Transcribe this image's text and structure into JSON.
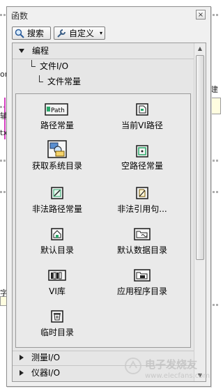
{
  "background": {
    "left_fragment_1": "or",
    "left_fragment_2": "辅",
    "left_fragment_3": "tx",
    "left_fragment_4": "字",
    "right_fragment_1": "建"
  },
  "palette": {
    "title": "函数",
    "close_glyph": "×",
    "toolbar": {
      "search_label": "搜索",
      "customize_label": "自定义",
      "customize_arrow": "▾"
    },
    "tree": {
      "root_label": "编程",
      "child_label": "文件I/O",
      "grandchild_label": "文件常量"
    },
    "items": [
      {
        "label": "路径常量",
        "icon": "path-constant-icon"
      },
      {
        "label": "当前VI路径",
        "icon": "current-vi-path-icon"
      },
      {
        "label": "获取系统目录",
        "icon": "get-system-directory-icon"
      },
      {
        "label": "空路径常量",
        "icon": "empty-path-icon"
      },
      {
        "label": "非法路径常量",
        "icon": "not-a-path-icon"
      },
      {
        "label": "非法引用句...",
        "icon": "not-a-refnum-icon"
      },
      {
        "label": "默认目录",
        "icon": "default-directory-icon"
      },
      {
        "label": "默认数据目录",
        "icon": "default-data-directory-icon"
      },
      {
        "label": "VI库",
        "icon": "vi-library-icon"
      },
      {
        "label": "应用程序目录",
        "icon": "application-directory-icon"
      },
      {
        "label": "临时目录",
        "icon": "temporary-directory-icon"
      }
    ],
    "path_icon_text": "Path",
    "collapsed": [
      {
        "label": "测量I/O"
      },
      {
        "label": "仪器I/O"
      }
    ]
  },
  "watermark": {
    "line1": "电子发烧友",
    "line2": "www.elecfans.com"
  }
}
